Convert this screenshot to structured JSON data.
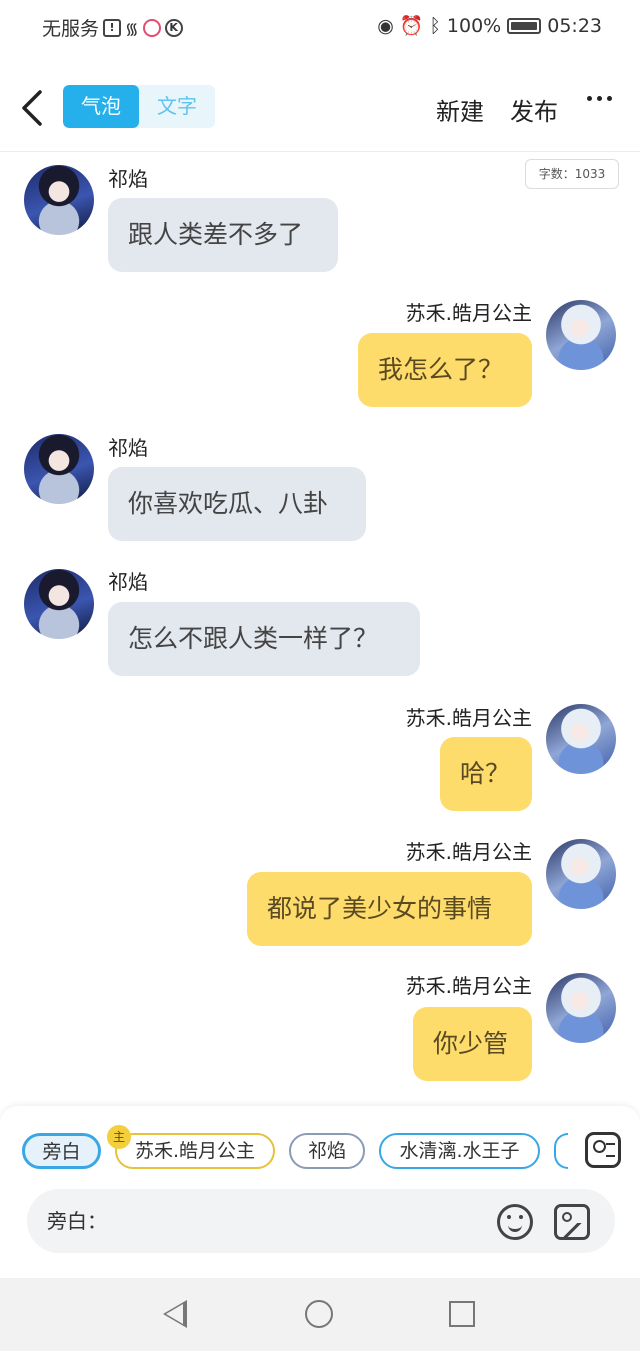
{
  "status_bar": {
    "carrier": "无服务",
    "battery": "100%",
    "time": "05:23"
  },
  "header": {
    "tabs": [
      {
        "label": "气泡",
        "active": true
      },
      {
        "label": "文字",
        "active": false
      }
    ],
    "new_label": "新建",
    "publish_label": "发布"
  },
  "word_count": "字数：1033",
  "messages": [
    {
      "side": "left",
      "sender": "祁焰",
      "text": "跟人类差不多了"
    },
    {
      "side": "right",
      "sender": "苏禾.皓月公主",
      "text": "我怎么了？"
    },
    {
      "side": "left",
      "sender": "祁焰",
      "text": "你喜欢吃瓜、八卦"
    },
    {
      "side": "left",
      "sender": "祁焰",
      "text": "怎么不跟人类一样了？"
    },
    {
      "side": "right",
      "sender": "苏禾.皓月公主",
      "text": "哈？"
    },
    {
      "side": "right",
      "sender": "苏禾.皓月公主",
      "text": "都说了美少女的事情"
    },
    {
      "side": "right",
      "sender": "苏禾.皓月公主",
      "text": "你少管"
    }
  ],
  "roles": {
    "items": [
      {
        "label": "旁白",
        "selected": true
      },
      {
        "label": "苏禾.皓月公主",
        "badge": "主"
      },
      {
        "label": "祁焰"
      },
      {
        "label": "水清漓.水王子"
      }
    ]
  },
  "composer": {
    "label": "旁白："
  },
  "colors": {
    "accent": "#25b0ec",
    "bubble_self": "#fddc6b",
    "bubble_other": "#e3e7ee"
  }
}
